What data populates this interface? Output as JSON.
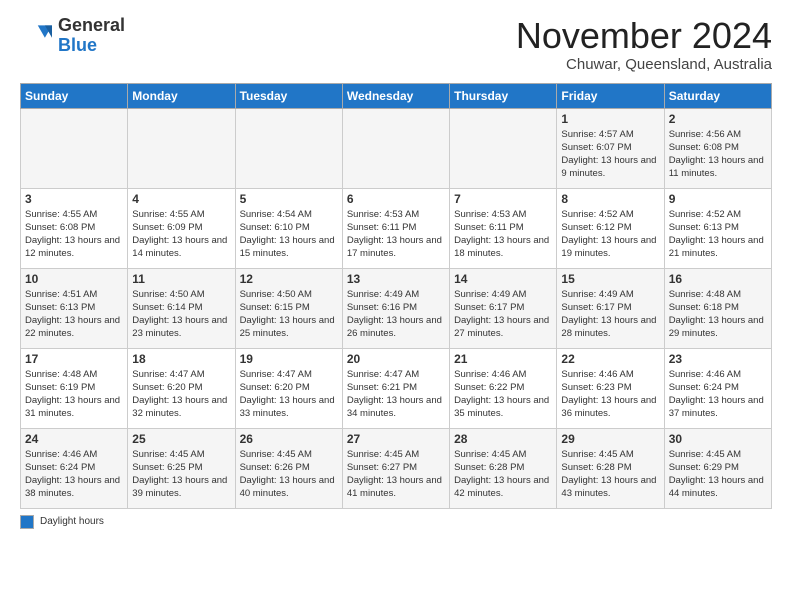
{
  "logo": {
    "general": "General",
    "blue": "Blue"
  },
  "title": "November 2024",
  "location": "Chuwar, Queensland, Australia",
  "days_of_week": [
    "Sunday",
    "Monday",
    "Tuesday",
    "Wednesday",
    "Thursday",
    "Friday",
    "Saturday"
  ],
  "footer": {
    "legend_label": "Daylight hours"
  },
  "weeks": [
    [
      {
        "day": "",
        "info": ""
      },
      {
        "day": "",
        "info": ""
      },
      {
        "day": "",
        "info": ""
      },
      {
        "day": "",
        "info": ""
      },
      {
        "day": "",
        "info": ""
      },
      {
        "day": "1",
        "info": "Sunrise: 4:57 AM\nSunset: 6:07 PM\nDaylight: 13 hours and 9 minutes."
      },
      {
        "day": "2",
        "info": "Sunrise: 4:56 AM\nSunset: 6:08 PM\nDaylight: 13 hours and 11 minutes."
      }
    ],
    [
      {
        "day": "3",
        "info": "Sunrise: 4:55 AM\nSunset: 6:08 PM\nDaylight: 13 hours and 12 minutes."
      },
      {
        "day": "4",
        "info": "Sunrise: 4:55 AM\nSunset: 6:09 PM\nDaylight: 13 hours and 14 minutes."
      },
      {
        "day": "5",
        "info": "Sunrise: 4:54 AM\nSunset: 6:10 PM\nDaylight: 13 hours and 15 minutes."
      },
      {
        "day": "6",
        "info": "Sunrise: 4:53 AM\nSunset: 6:11 PM\nDaylight: 13 hours and 17 minutes."
      },
      {
        "day": "7",
        "info": "Sunrise: 4:53 AM\nSunset: 6:11 PM\nDaylight: 13 hours and 18 minutes."
      },
      {
        "day": "8",
        "info": "Sunrise: 4:52 AM\nSunset: 6:12 PM\nDaylight: 13 hours and 19 minutes."
      },
      {
        "day": "9",
        "info": "Sunrise: 4:52 AM\nSunset: 6:13 PM\nDaylight: 13 hours and 21 minutes."
      }
    ],
    [
      {
        "day": "10",
        "info": "Sunrise: 4:51 AM\nSunset: 6:13 PM\nDaylight: 13 hours and 22 minutes."
      },
      {
        "day": "11",
        "info": "Sunrise: 4:50 AM\nSunset: 6:14 PM\nDaylight: 13 hours and 23 minutes."
      },
      {
        "day": "12",
        "info": "Sunrise: 4:50 AM\nSunset: 6:15 PM\nDaylight: 13 hours and 25 minutes."
      },
      {
        "day": "13",
        "info": "Sunrise: 4:49 AM\nSunset: 6:16 PM\nDaylight: 13 hours and 26 minutes."
      },
      {
        "day": "14",
        "info": "Sunrise: 4:49 AM\nSunset: 6:17 PM\nDaylight: 13 hours and 27 minutes."
      },
      {
        "day": "15",
        "info": "Sunrise: 4:49 AM\nSunset: 6:17 PM\nDaylight: 13 hours and 28 minutes."
      },
      {
        "day": "16",
        "info": "Sunrise: 4:48 AM\nSunset: 6:18 PM\nDaylight: 13 hours and 29 minutes."
      }
    ],
    [
      {
        "day": "17",
        "info": "Sunrise: 4:48 AM\nSunset: 6:19 PM\nDaylight: 13 hours and 31 minutes."
      },
      {
        "day": "18",
        "info": "Sunrise: 4:47 AM\nSunset: 6:20 PM\nDaylight: 13 hours and 32 minutes."
      },
      {
        "day": "19",
        "info": "Sunrise: 4:47 AM\nSunset: 6:20 PM\nDaylight: 13 hours and 33 minutes."
      },
      {
        "day": "20",
        "info": "Sunrise: 4:47 AM\nSunset: 6:21 PM\nDaylight: 13 hours and 34 minutes."
      },
      {
        "day": "21",
        "info": "Sunrise: 4:46 AM\nSunset: 6:22 PM\nDaylight: 13 hours and 35 minutes."
      },
      {
        "day": "22",
        "info": "Sunrise: 4:46 AM\nSunset: 6:23 PM\nDaylight: 13 hours and 36 minutes."
      },
      {
        "day": "23",
        "info": "Sunrise: 4:46 AM\nSunset: 6:24 PM\nDaylight: 13 hours and 37 minutes."
      }
    ],
    [
      {
        "day": "24",
        "info": "Sunrise: 4:46 AM\nSunset: 6:24 PM\nDaylight: 13 hours and 38 minutes."
      },
      {
        "day": "25",
        "info": "Sunrise: 4:45 AM\nSunset: 6:25 PM\nDaylight: 13 hours and 39 minutes."
      },
      {
        "day": "26",
        "info": "Sunrise: 4:45 AM\nSunset: 6:26 PM\nDaylight: 13 hours and 40 minutes."
      },
      {
        "day": "27",
        "info": "Sunrise: 4:45 AM\nSunset: 6:27 PM\nDaylight: 13 hours and 41 minutes."
      },
      {
        "day": "28",
        "info": "Sunrise: 4:45 AM\nSunset: 6:28 PM\nDaylight: 13 hours and 42 minutes."
      },
      {
        "day": "29",
        "info": "Sunrise: 4:45 AM\nSunset: 6:28 PM\nDaylight: 13 hours and 43 minutes."
      },
      {
        "day": "30",
        "info": "Sunrise: 4:45 AM\nSunset: 6:29 PM\nDaylight: 13 hours and 44 minutes."
      }
    ]
  ]
}
